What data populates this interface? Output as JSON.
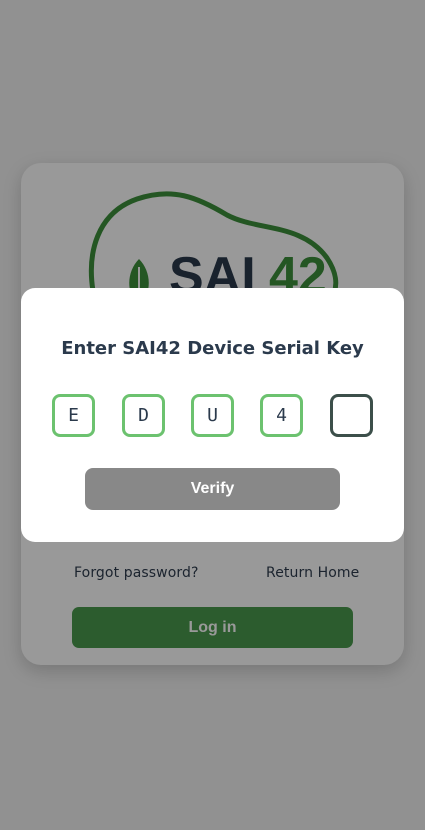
{
  "login": {
    "logo_text_primary": "SAI",
    "logo_text_accent": "42",
    "forgot_password": "Forgot password?",
    "return_home": "Return Home",
    "login_button": "Log in"
  },
  "dialog": {
    "title": "Enter SAI42 Device Serial Key",
    "key_chars": [
      "E",
      "D",
      "U",
      "4",
      ""
    ],
    "verify_button": "Verify"
  },
  "colors": {
    "brand_green": "#4a9a4d",
    "input_border_green": "#6cc26f",
    "active_border": "#3c4f4a",
    "verify_button_gray": "#888888",
    "text_dark": "#2b3a4c"
  }
}
